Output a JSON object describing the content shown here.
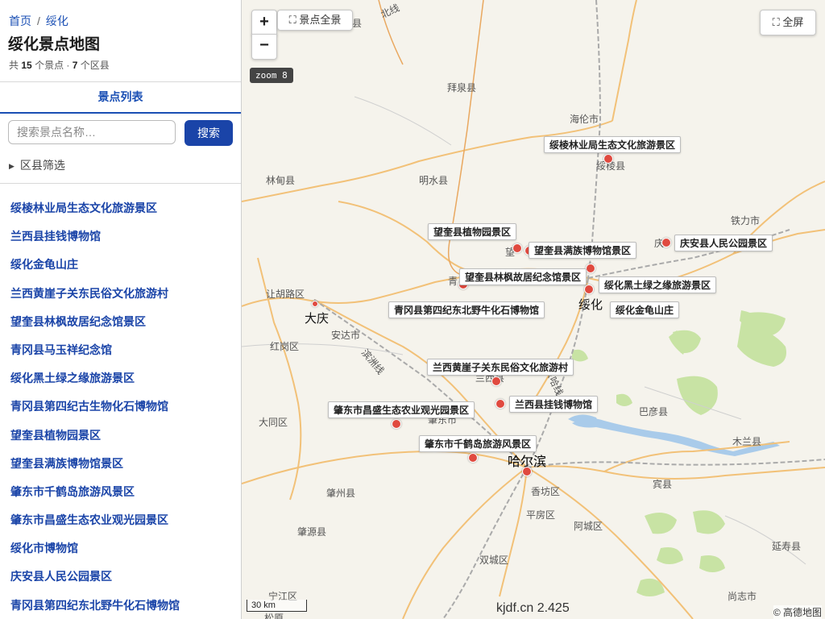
{
  "breadcrumb": {
    "home": "首页",
    "separator": "/",
    "current": "绥化"
  },
  "page_title": "绥化景点地图",
  "stats": {
    "prefix": "共",
    "spot_count": "15",
    "spot_unit": "个景点 ·",
    "district_count": "7",
    "district_unit": "个区县"
  },
  "tab_label": "景点列表",
  "search": {
    "placeholder": "搜索景点名称…",
    "button_label": "搜索"
  },
  "filter_label": "区县筛选",
  "spots": [
    "绥棱林业局生态文化旅游景区",
    "兰西县挂钱博物馆",
    "绥化金龟山庄",
    "兰西黄崖子关东民俗文化旅游村",
    "望奎县林枫故居纪念馆景区",
    "青冈县马玉祥纪念馆",
    "绥化黑土绿之缘旅游景区",
    "青冈县第四纪古生物化石博物馆",
    "望奎县植物园景区",
    "望奎县满族博物馆景区",
    "肇东市千鹤岛旅游风景区",
    "肇东市昌盛生态农业观光园景区",
    "绥化市博物馆",
    "庆安县人民公园景区",
    "青冈县第四纪东北野牛化石博物馆"
  ],
  "map": {
    "zoom_in": "+",
    "zoom_out": "−",
    "overview_label": "景点全景",
    "fullscreen_label": "全屏",
    "zoom_level": "zoom 8",
    "scale_label": "30 km",
    "watermark": "kjdf.cn 2.425",
    "copyright": "© 高德地图",
    "marker_labels": [
      "绥棱林业局生态文化旅游景区",
      "望奎县植物园景区",
      "望奎县满族博物馆景区",
      "庆安县人民公园景区",
      "望奎县林枫故居纪念馆景区",
      "绥化黑土绿之缘旅游景区",
      "青冈县第四纪东北野牛化石博物馆",
      "绥化金龟山庄",
      "兰西黄崖子关东民俗文化旅游村",
      "兰西县挂钱博物馆",
      "肇东市昌盛生态农业观光园景区",
      "肇东市千鹤岛旅游风景区"
    ],
    "places": [
      "县",
      "北线",
      "拜泉县",
      "海伦市",
      "绥棱县",
      "林甸县",
      "明水县",
      "铁力市",
      "望",
      "庆",
      "青",
      "让胡路区",
      "大庆",
      "绥化",
      "安达市",
      "红岗区",
      "兰西县",
      "巴彦县",
      "大同区",
      "肇东市",
      "哈尔滨",
      "木兰县",
      "香坊区",
      "宾县",
      "肇州县",
      "平房区",
      "阿城区",
      "肇源县",
      "延寿县",
      "双城区",
      "宁江区",
      "尚志市",
      "松原",
      "滨洲线",
      "京哈线"
    ]
  }
}
